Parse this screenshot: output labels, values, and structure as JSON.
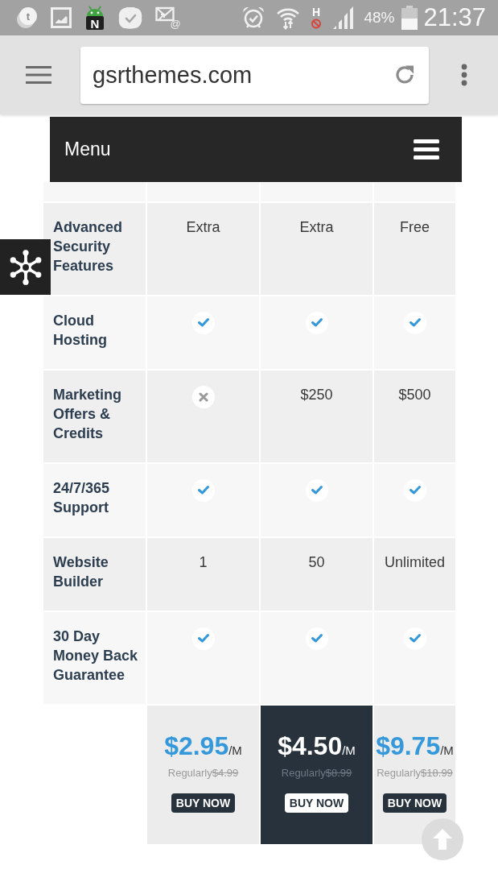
{
  "status_bar": {
    "notifications": [
      {
        "kind": "app",
        "letter": "t"
      },
      {
        "kind": "gallery"
      },
      {
        "kind": "news",
        "letter": "N"
      },
      {
        "kind": "chat"
      },
      {
        "kind": "mail",
        "letter": "@"
      }
    ],
    "network_type": "H",
    "battery_percent": "48%",
    "time": "21:37"
  },
  "browser": {
    "url": "gsrthemes.com"
  },
  "site_menu": {
    "label": "Menu"
  },
  "pricing_table": {
    "rows": [
      {
        "feature": "Advanced Security Features",
        "cells": [
          {
            "kind": "text",
            "text": "Extra"
          },
          {
            "kind": "text",
            "text": "Extra"
          },
          {
            "kind": "text",
            "text": "Free"
          }
        ]
      },
      {
        "feature": "Cloud Hosting",
        "cells": [
          {
            "kind": "check"
          },
          {
            "kind": "check"
          },
          {
            "kind": "check"
          }
        ]
      },
      {
        "feature": "Marketing Offers & Credits",
        "cells": [
          {
            "kind": "cross"
          },
          {
            "kind": "text",
            "text": "$250"
          },
          {
            "kind": "text",
            "text": "$500"
          }
        ]
      },
      {
        "feature": "24/7/365 Support",
        "cells": [
          {
            "kind": "check"
          },
          {
            "kind": "check"
          },
          {
            "kind": "check"
          }
        ]
      },
      {
        "feature": "Website Builder",
        "cells": [
          {
            "kind": "text",
            "text": "1"
          },
          {
            "kind": "text",
            "text": "50"
          },
          {
            "kind": "text",
            "text": "Unlimited"
          }
        ]
      },
      {
        "feature": "30 Day Money Back Guarantee",
        "cells": [
          {
            "kind": "check"
          },
          {
            "kind": "check"
          },
          {
            "kind": "check"
          }
        ]
      }
    ],
    "plans": [
      {
        "price": "$2.95",
        "period": "/M",
        "regular_label": "Regularly",
        "regular_price": "$4.99",
        "button": "BUY NOW",
        "featured": false
      },
      {
        "price": "$4.50",
        "period": "/M",
        "regular_label": "Regularly",
        "regular_price": "$8.99",
        "button": "BUY NOW",
        "featured": true
      },
      {
        "price": "$9.75",
        "period": "/M",
        "regular_label": "Regularly",
        "regular_price": "$18.99",
        "button": "BUY NOW",
        "featured": false
      }
    ]
  }
}
